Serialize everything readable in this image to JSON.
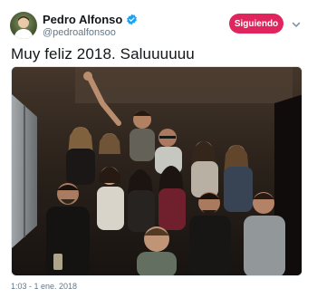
{
  "author": {
    "display_name": "Pedro Alfonso",
    "handle": "@pedroalfonsoo",
    "verified": true
  },
  "follow_button": {
    "label": "Siguiendo",
    "color": "#e0245e"
  },
  "menu": {
    "icon": "chevron-down-icon"
  },
  "tweet": {
    "text": "Muy feliz 2018. Saluuuuuu",
    "timestamp": "1:03 - 1 ene. 2018"
  },
  "media": {
    "type": "photo",
    "icon": "group-photo"
  },
  "colors": {
    "verified": "#1da1f2",
    "secondary_text": "#657786",
    "primary_text": "#14171a"
  }
}
